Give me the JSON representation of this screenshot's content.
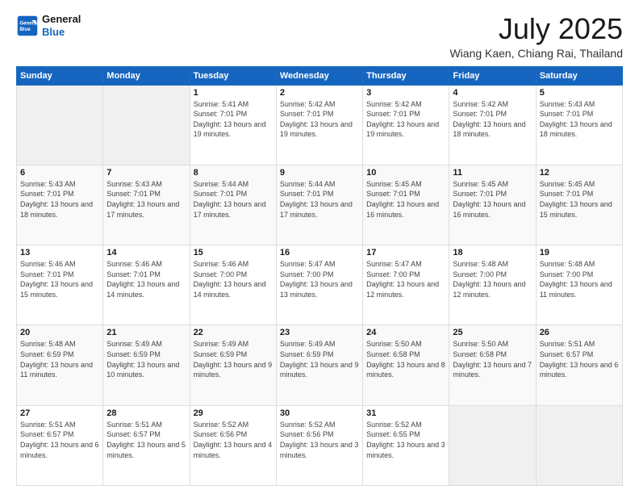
{
  "header": {
    "logo_line1": "General",
    "logo_line2": "Blue",
    "title": "July 2025",
    "subtitle": "Wiang Kaen, Chiang Rai, Thailand"
  },
  "weekdays": [
    "Sunday",
    "Monday",
    "Tuesday",
    "Wednesday",
    "Thursday",
    "Friday",
    "Saturday"
  ],
  "weeks": [
    [
      {
        "day": "",
        "sunrise": "",
        "sunset": "",
        "daylight": ""
      },
      {
        "day": "",
        "sunrise": "",
        "sunset": "",
        "daylight": ""
      },
      {
        "day": "1",
        "sunrise": "Sunrise: 5:41 AM",
        "sunset": "Sunset: 7:01 PM",
        "daylight": "Daylight: 13 hours and 19 minutes."
      },
      {
        "day": "2",
        "sunrise": "Sunrise: 5:42 AM",
        "sunset": "Sunset: 7:01 PM",
        "daylight": "Daylight: 13 hours and 19 minutes."
      },
      {
        "day": "3",
        "sunrise": "Sunrise: 5:42 AM",
        "sunset": "Sunset: 7:01 PM",
        "daylight": "Daylight: 13 hours and 19 minutes."
      },
      {
        "day": "4",
        "sunrise": "Sunrise: 5:42 AM",
        "sunset": "Sunset: 7:01 PM",
        "daylight": "Daylight: 13 hours and 18 minutes."
      },
      {
        "day": "5",
        "sunrise": "Sunrise: 5:43 AM",
        "sunset": "Sunset: 7:01 PM",
        "daylight": "Daylight: 13 hours and 18 minutes."
      }
    ],
    [
      {
        "day": "6",
        "sunrise": "Sunrise: 5:43 AM",
        "sunset": "Sunset: 7:01 PM",
        "daylight": "Daylight: 13 hours and 18 minutes."
      },
      {
        "day": "7",
        "sunrise": "Sunrise: 5:43 AM",
        "sunset": "Sunset: 7:01 PM",
        "daylight": "Daylight: 13 hours and 17 minutes."
      },
      {
        "day": "8",
        "sunrise": "Sunrise: 5:44 AM",
        "sunset": "Sunset: 7:01 PM",
        "daylight": "Daylight: 13 hours and 17 minutes."
      },
      {
        "day": "9",
        "sunrise": "Sunrise: 5:44 AM",
        "sunset": "Sunset: 7:01 PM",
        "daylight": "Daylight: 13 hours and 17 minutes."
      },
      {
        "day": "10",
        "sunrise": "Sunrise: 5:45 AM",
        "sunset": "Sunset: 7:01 PM",
        "daylight": "Daylight: 13 hours and 16 minutes."
      },
      {
        "day": "11",
        "sunrise": "Sunrise: 5:45 AM",
        "sunset": "Sunset: 7:01 PM",
        "daylight": "Daylight: 13 hours and 16 minutes."
      },
      {
        "day": "12",
        "sunrise": "Sunrise: 5:45 AM",
        "sunset": "Sunset: 7:01 PM",
        "daylight": "Daylight: 13 hours and 15 minutes."
      }
    ],
    [
      {
        "day": "13",
        "sunrise": "Sunrise: 5:46 AM",
        "sunset": "Sunset: 7:01 PM",
        "daylight": "Daylight: 13 hours and 15 minutes."
      },
      {
        "day": "14",
        "sunrise": "Sunrise: 5:46 AM",
        "sunset": "Sunset: 7:01 PM",
        "daylight": "Daylight: 13 hours and 14 minutes."
      },
      {
        "day": "15",
        "sunrise": "Sunrise: 5:46 AM",
        "sunset": "Sunset: 7:00 PM",
        "daylight": "Daylight: 13 hours and 14 minutes."
      },
      {
        "day": "16",
        "sunrise": "Sunrise: 5:47 AM",
        "sunset": "Sunset: 7:00 PM",
        "daylight": "Daylight: 13 hours and 13 minutes."
      },
      {
        "day": "17",
        "sunrise": "Sunrise: 5:47 AM",
        "sunset": "Sunset: 7:00 PM",
        "daylight": "Daylight: 13 hours and 12 minutes."
      },
      {
        "day": "18",
        "sunrise": "Sunrise: 5:48 AM",
        "sunset": "Sunset: 7:00 PM",
        "daylight": "Daylight: 13 hours and 12 minutes."
      },
      {
        "day": "19",
        "sunrise": "Sunrise: 5:48 AM",
        "sunset": "Sunset: 7:00 PM",
        "daylight": "Daylight: 13 hours and 11 minutes."
      }
    ],
    [
      {
        "day": "20",
        "sunrise": "Sunrise: 5:48 AM",
        "sunset": "Sunset: 6:59 PM",
        "daylight": "Daylight: 13 hours and 11 minutes."
      },
      {
        "day": "21",
        "sunrise": "Sunrise: 5:49 AM",
        "sunset": "Sunset: 6:59 PM",
        "daylight": "Daylight: 13 hours and 10 minutes."
      },
      {
        "day": "22",
        "sunrise": "Sunrise: 5:49 AM",
        "sunset": "Sunset: 6:59 PM",
        "daylight": "Daylight: 13 hours and 9 minutes."
      },
      {
        "day": "23",
        "sunrise": "Sunrise: 5:49 AM",
        "sunset": "Sunset: 6:59 PM",
        "daylight": "Daylight: 13 hours and 9 minutes."
      },
      {
        "day": "24",
        "sunrise": "Sunrise: 5:50 AM",
        "sunset": "Sunset: 6:58 PM",
        "daylight": "Daylight: 13 hours and 8 minutes."
      },
      {
        "day": "25",
        "sunrise": "Sunrise: 5:50 AM",
        "sunset": "Sunset: 6:58 PM",
        "daylight": "Daylight: 13 hours and 7 minutes."
      },
      {
        "day": "26",
        "sunrise": "Sunrise: 5:51 AM",
        "sunset": "Sunset: 6:57 PM",
        "daylight": "Daylight: 13 hours and 6 minutes."
      }
    ],
    [
      {
        "day": "27",
        "sunrise": "Sunrise: 5:51 AM",
        "sunset": "Sunset: 6:57 PM",
        "daylight": "Daylight: 13 hours and 6 minutes."
      },
      {
        "day": "28",
        "sunrise": "Sunrise: 5:51 AM",
        "sunset": "Sunset: 6:57 PM",
        "daylight": "Daylight: 13 hours and 5 minutes."
      },
      {
        "day": "29",
        "sunrise": "Sunrise: 5:52 AM",
        "sunset": "Sunset: 6:56 PM",
        "daylight": "Daylight: 13 hours and 4 minutes."
      },
      {
        "day": "30",
        "sunrise": "Sunrise: 5:52 AM",
        "sunset": "Sunset: 6:56 PM",
        "daylight": "Daylight: 13 hours and 3 minutes."
      },
      {
        "day": "31",
        "sunrise": "Sunrise: 5:52 AM",
        "sunset": "Sunset: 6:55 PM",
        "daylight": "Daylight: 13 hours and 3 minutes."
      },
      {
        "day": "",
        "sunrise": "",
        "sunset": "",
        "daylight": ""
      },
      {
        "day": "",
        "sunrise": "",
        "sunset": "",
        "daylight": ""
      }
    ]
  ]
}
